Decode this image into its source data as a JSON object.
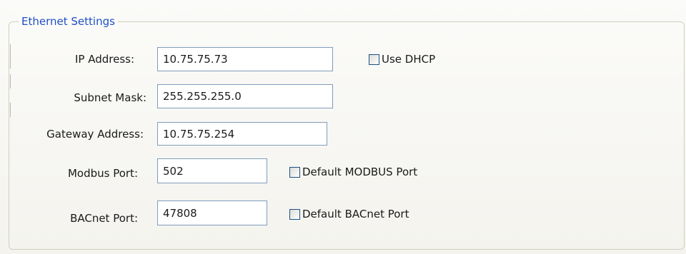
{
  "group": {
    "title": "Ethernet Settings"
  },
  "fields": {
    "ip_address": {
      "label": "IP Address:",
      "value": "10.75.75.73"
    },
    "subnet_mask": {
      "label": "Subnet Mask:",
      "value": "255.255.255.0"
    },
    "gateway_address": {
      "label": "Gateway Address:",
      "value": "10.75.75.254"
    },
    "modbus_port": {
      "label": "Modbus Port:",
      "value": "502"
    },
    "bacnet_port": {
      "label": "BACnet Port:",
      "value": "47808"
    }
  },
  "checkboxes": {
    "use_dhcp": {
      "label": "Use DHCP",
      "checked": false
    },
    "default_modbus_port": {
      "label": "Default MODBUS Port",
      "checked": false
    },
    "default_bacnet_port": {
      "label": "Default BACnet Port",
      "checked": false
    }
  },
  "colors": {
    "group_title": "#1f4fc7",
    "textbox_border": "#7f9db9",
    "checkbox_border": "#1c5180"
  }
}
